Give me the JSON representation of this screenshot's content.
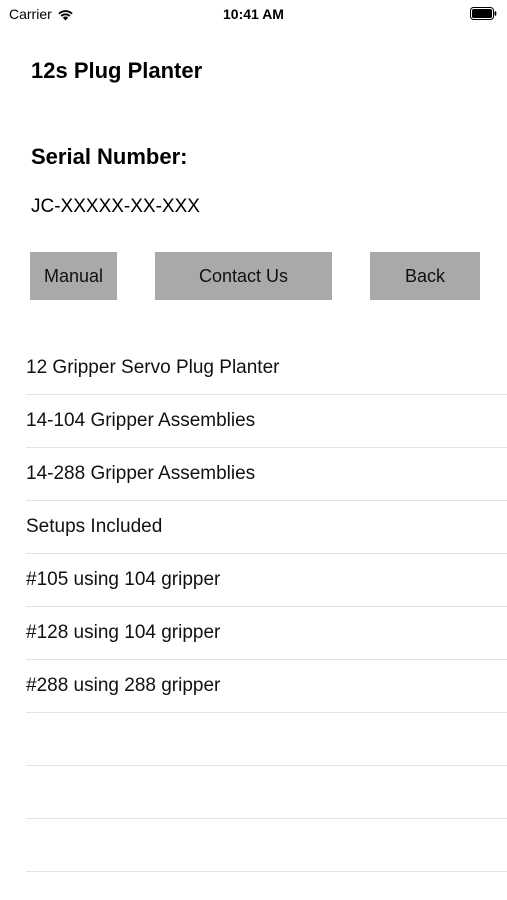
{
  "status_bar": {
    "carrier": "Carrier",
    "time": "10:41 AM",
    "icons": [
      "wifi-icon",
      "battery-icon"
    ]
  },
  "header": {
    "title": "12s Plug Planter"
  },
  "serial": {
    "label": "Serial Number:",
    "value": "JC-XXXXX-XX-XXX"
  },
  "buttons": {
    "manual": "Manual",
    "contact": "Contact Us",
    "back": "Back",
    "color": "#a9a9a9"
  },
  "list": {
    "items": [
      "12 Gripper Servo Plug Planter",
      "14-104 Gripper Assemblies",
      "14-288 Gripper Assemblies",
      "Setups Included",
      "#105 using 104 gripper",
      "#128 using 104 gripper",
      "#288 using 288 gripper",
      "",
      "",
      ""
    ]
  }
}
